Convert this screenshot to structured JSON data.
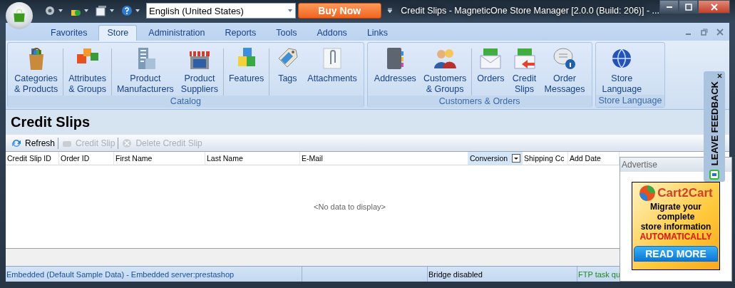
{
  "window": {
    "title": "Credit Slips - MagneticOne Store Manager [2.0.0 (Build: 206)] - ..."
  },
  "quick_access": {
    "language": "English (United States)",
    "buy_button": "Buy Now"
  },
  "tabs": [
    {
      "label": "Favorites",
      "selected": false
    },
    {
      "label": "Store",
      "selected": true
    },
    {
      "label": "Administration",
      "selected": false
    },
    {
      "label": "Reports",
      "selected": false
    },
    {
      "label": "Tools",
      "selected": false
    },
    {
      "label": "Addons",
      "selected": false
    },
    {
      "label": "Links",
      "selected": false
    }
  ],
  "ribbon_groups": [
    {
      "label": "Catalog",
      "buttons": [
        {
          "lines": [
            "Categories",
            "& Products"
          ],
          "divider_after": true
        },
        {
          "lines": [
            "Attributes",
            "& Groups"
          ],
          "divider_after": true
        },
        {
          "lines": [
            "Product",
            "Manufacturers"
          ],
          "divider_after": false
        },
        {
          "lines": [
            "Product",
            "Suppliers"
          ],
          "divider_after": true
        },
        {
          "lines": [
            "Features"
          ],
          "divider_after": true
        },
        {
          "lines": [
            "Tags"
          ],
          "divider_after": false
        },
        {
          "lines": [
            "Attachments"
          ],
          "divider_after": false
        }
      ]
    },
    {
      "label": "Customers & Orders",
      "buttons": [
        {
          "lines": [
            "Addresses"
          ],
          "divider_after": false
        },
        {
          "lines": [
            "Customers",
            "& Groups"
          ],
          "divider_after": true
        },
        {
          "lines": [
            "Orders"
          ],
          "divider_after": false
        },
        {
          "lines": [
            "Credit",
            "Slips"
          ],
          "divider_after": false
        },
        {
          "lines": [
            "Order",
            "Messages"
          ],
          "divider_after": false
        }
      ]
    },
    {
      "label": "Store Language",
      "buttons": [
        {
          "lines": [
            "Store",
            "Language"
          ],
          "divider_after": false
        }
      ]
    }
  ],
  "page": {
    "heading": "Credit Slips"
  },
  "toolbar": [
    {
      "label": "Refresh",
      "disabled": false
    },
    {
      "label": "Credit Slip",
      "disabled": true
    },
    {
      "label": "Delete Credit Slip",
      "disabled": true
    }
  ],
  "grid": {
    "columns": [
      {
        "label": "Credit Slip ID",
        "selected": false
      },
      {
        "label": "Order ID",
        "selected": false
      },
      {
        "label": "First Name",
        "selected": false
      },
      {
        "label": "Last Name",
        "selected": false
      },
      {
        "label": "E-Mail",
        "selected": false
      },
      {
        "label": "Conversion",
        "selected": true
      },
      {
        "label": "Shipping Cc",
        "selected": false
      },
      {
        "label": "Add Date",
        "selected": false
      }
    ],
    "empty_text": "<No data to display>"
  },
  "status_bar": [
    {
      "text": "Embedded (Default Sample Data) - Embedded server:prestashop",
      "color": "#1a4f9c"
    },
    {
      "text": "Bridge disabled",
      "color": "#000000"
    },
    {
      "text": "FTP task qu",
      "color": "#1e8a1e"
    }
  ],
  "advert": {
    "title": "Advertise",
    "brand": "Cart2Cart",
    "lines": [
      "Migrate your",
      "complete",
      "store information"
    ],
    "highlight": "AUTOMATICALLY",
    "button": "READ MORE"
  },
  "feedback_tab": {
    "label": "LEAVE FEEDBACK"
  }
}
